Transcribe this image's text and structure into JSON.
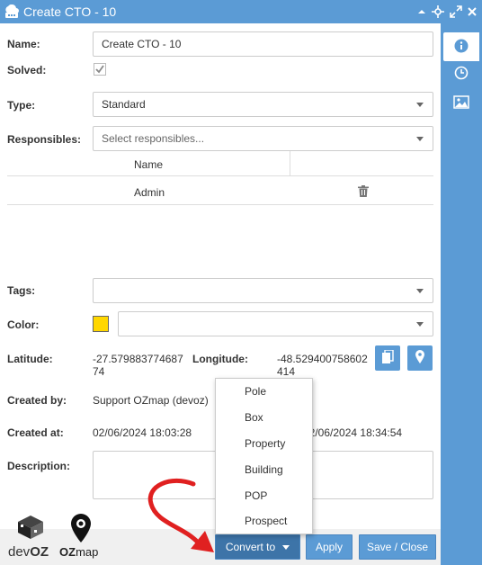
{
  "window": {
    "title": "Create CTO - 10"
  },
  "form": {
    "name_label": "Name:",
    "name_value": "Create CTO - 10",
    "solved_label": "Solved:",
    "type_label": "Type:",
    "type_value": "Standard",
    "responsibles_label": "Responsibles:",
    "responsibles_placeholder": "Select responsibles...",
    "table": {
      "headers": [
        "Name"
      ],
      "rows": [
        {
          "name": "Admin"
        }
      ]
    },
    "tags_label": "Tags:",
    "color_label": "Color:",
    "color_value": "#ffd700",
    "latitude_label": "Latitude:",
    "latitude_line1": "-27.579883774687",
    "latitude_line2": "74",
    "longitude_label": "Longitude:",
    "longitude_line1": "-48.529400758602",
    "longitude_line2": "414",
    "created_by_label": "Created by:",
    "created_by_value": "Support OZmap (devoz)",
    "created_at_label": "Created at:",
    "created_at_value": "02/06/2024 18:03:28",
    "updated_at_value": "02/06/2024 18:34:54",
    "description_label": "Description:"
  },
  "menu": {
    "items": [
      "Pole",
      "Box",
      "Property",
      "Building",
      "POP",
      "Prospect"
    ]
  },
  "footer": {
    "convert_label": "Convert to",
    "apply_label": "Apply",
    "save_close_label": "Save / Close"
  },
  "logos": {
    "devoz_text_light": "dev",
    "devoz_text_bold": "OZ",
    "ozmap_text_bold": "OZ",
    "ozmap_text_light": "map"
  },
  "colors": {
    "accent": "#5b9bd5",
    "accent_dark": "#3d74a8",
    "arrow": "#e02020"
  },
  "icons": [
    "cto-icon",
    "chevron-up-icon",
    "move-icon",
    "expand-icon",
    "close-icon",
    "info-icon",
    "clock-icon",
    "image-icon",
    "checkbox-icon",
    "trash-icon",
    "copy-icon",
    "map-pin-icon"
  ]
}
